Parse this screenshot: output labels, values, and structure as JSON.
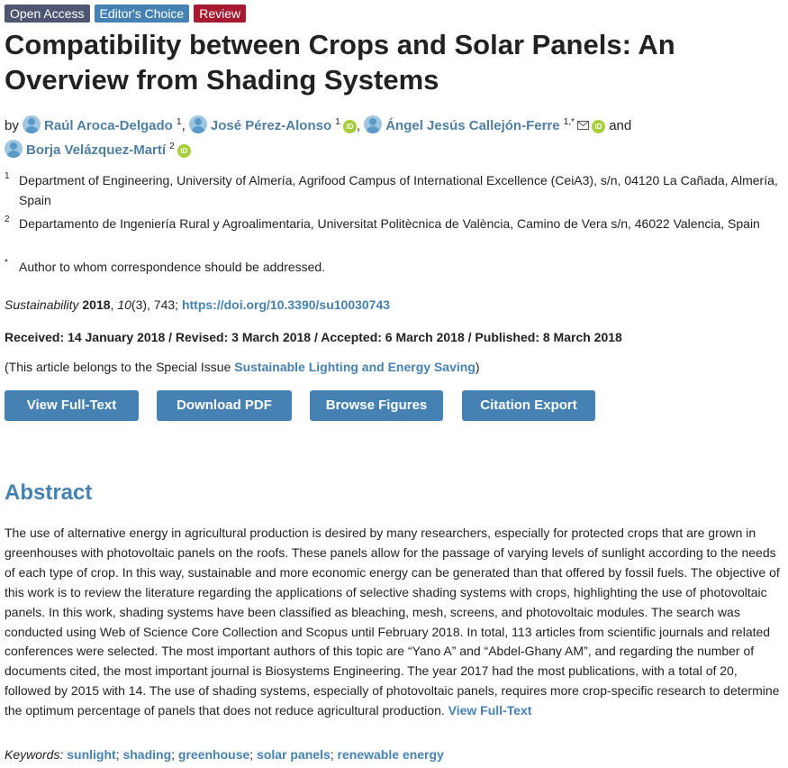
{
  "badges": {
    "open_access": "Open Access",
    "editors_choice": "Editor's Choice",
    "review": "Review"
  },
  "title": "Compatibility between Crops and Solar Panels: An Overview from Shading Systems",
  "authors": {
    "by": "by",
    "list": [
      {
        "name": "Raúl Aroca-Delgado",
        "sup": "1"
      },
      {
        "name": "José Pérez-Alonso",
        "sup": "1"
      },
      {
        "name": "Ángel Jesús Callejón-Ferre",
        "sup": "1,*"
      },
      {
        "name": "Borja Velázquez-Martí",
        "sup": "2"
      }
    ],
    "and": "and",
    "orcid_label": "iD"
  },
  "affiliations": [
    {
      "num": "1",
      "text": "Department of Engineering, University of Almería, Agrifood Campus of International Excellence (CeiA3), s/n, 04120 La Cañada, Almería, Spain"
    },
    {
      "num": "2",
      "text": "Departamento de Ingeniería Rural y Agroalimentaria, Universitat Politècnica de València, Camino de Vera s/n, 46022 Valencia, Spain"
    },
    {
      "num": "*",
      "text": "Author to whom correspondence should be addressed."
    }
  ],
  "citation": {
    "journal": "Sustainability",
    "year": "2018",
    "volume": "10",
    "rest": "(3), 743;",
    "doi": "https://doi.org/10.3390/su10030743"
  },
  "dates": "Received: 14 January 2018 / Revised: 3 March 2018 / Accepted: 6 March 2018 / Published: 8 March 2018",
  "special_issue": {
    "prefix": "(This article belongs to the Special Issue ",
    "name": "Sustainable Lighting and Energy Saving",
    "suffix": ")"
  },
  "buttons": {
    "full_text": "View Full-Text",
    "pdf": "Download PDF",
    "figures": "Browse Figures",
    "citation": "Citation Export"
  },
  "abstract": {
    "heading": "Abstract",
    "text": "The use of alternative energy in agricultural production is desired by many researchers, especially for protected crops that are grown in greenhouses with photovoltaic panels on the roofs. These panels allow for the passage of varying levels of sunlight according to the needs of each type of crop. In this way, sustainable and more economic energy can be generated than that offered by fossil fuels. The objective of this work is to review the literature regarding the applications of selective shading systems with crops, highlighting the use of photovoltaic panels. In this work, shading systems have been classified as bleaching, mesh, screens, and photovoltaic modules. The search was conducted using Web of Science Core Collection and Scopus until February 2018. In total, 113 articles from scientific journals and related conferences were selected. The most important authors of this topic are “Yano A” and “Abdel-Ghany AM”, and regarding the number of documents cited, the most important journal is Biosystems Engineering. The year 2017 had the most publications, with a total of 20, followed by 2015 with 14. The use of shading systems, especially of photovoltaic panels, requires more crop-specific research to determine the optimum percentage of panels that does not reduce agricultural production.",
    "full_text_link": "View Full-Text"
  },
  "keywords": {
    "label": "Keywords:",
    "items": [
      "sunlight",
      "shading",
      "greenhouse",
      "solar panels",
      "renewable energy"
    ]
  }
}
